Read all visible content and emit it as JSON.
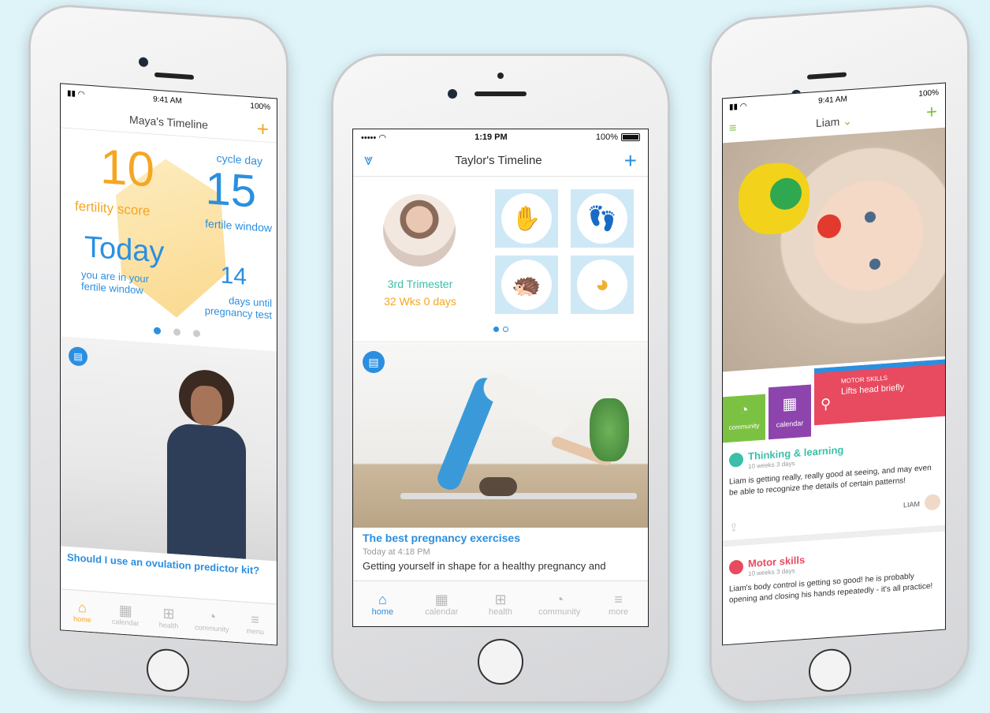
{
  "left_phone": {
    "status_time": "9:41 AM",
    "battery": "100%",
    "title": "Maya's Timeline",
    "fertility_score": "10",
    "fertility_label": "fertility score",
    "cycle_day_label": "cycle day",
    "cycle_day": "15",
    "fertile_window_label": "fertile window",
    "today": "Today",
    "today_sub": "you are in your fertile window",
    "days_until": "14",
    "days_until_label": "days until pregnancy test",
    "article": "Should I use an ovulation predictor kit?",
    "tabs": [
      "home",
      "calendar",
      "health",
      "community",
      "menu"
    ]
  },
  "center_phone": {
    "carrier": "•••••",
    "status_time": "1:19 PM",
    "battery": "100%",
    "title": "Taylor's Timeline",
    "trimester": "3rd Trimester",
    "weeks": "32 Wks 0 days",
    "article_title": "The best pregnancy exercises",
    "article_time": "Today at 4:18 PM",
    "article_snippet": "Getting yourself in shape for a healthy pregnancy and",
    "tabs": [
      "home",
      "calendar",
      "health",
      "community",
      "more"
    ]
  },
  "right_phone": {
    "status_time": "9:41 AM",
    "battery": "100%",
    "child_name": "Liam",
    "tile_community": "community",
    "tile_calendar": "calendar",
    "milestone_category": "MOTOR SKILLS",
    "milestone_text": "Lifts head briefly",
    "card1_title": "Thinking & learning",
    "card1_age": "10 weeks 3 days",
    "card1_body": "Liam is getting really, really good at seeing, and may even be able to recognize the details of certain patterns!",
    "card1_author": "LIAM",
    "card2_title": "Motor skills",
    "card2_age": "10 weeks 3 days",
    "card2_body": "Liam's body control is getting so good! he is probably opening and closing his hands repeatedly - it's all practice!"
  },
  "colors": {
    "background": "#def4f8",
    "accent_blue": "#2b8fe0",
    "orange": "#f5a623",
    "teal": "#3bbfa8",
    "green": "#7cc242",
    "purple": "#8e44ad",
    "red": "#e84a5f"
  }
}
